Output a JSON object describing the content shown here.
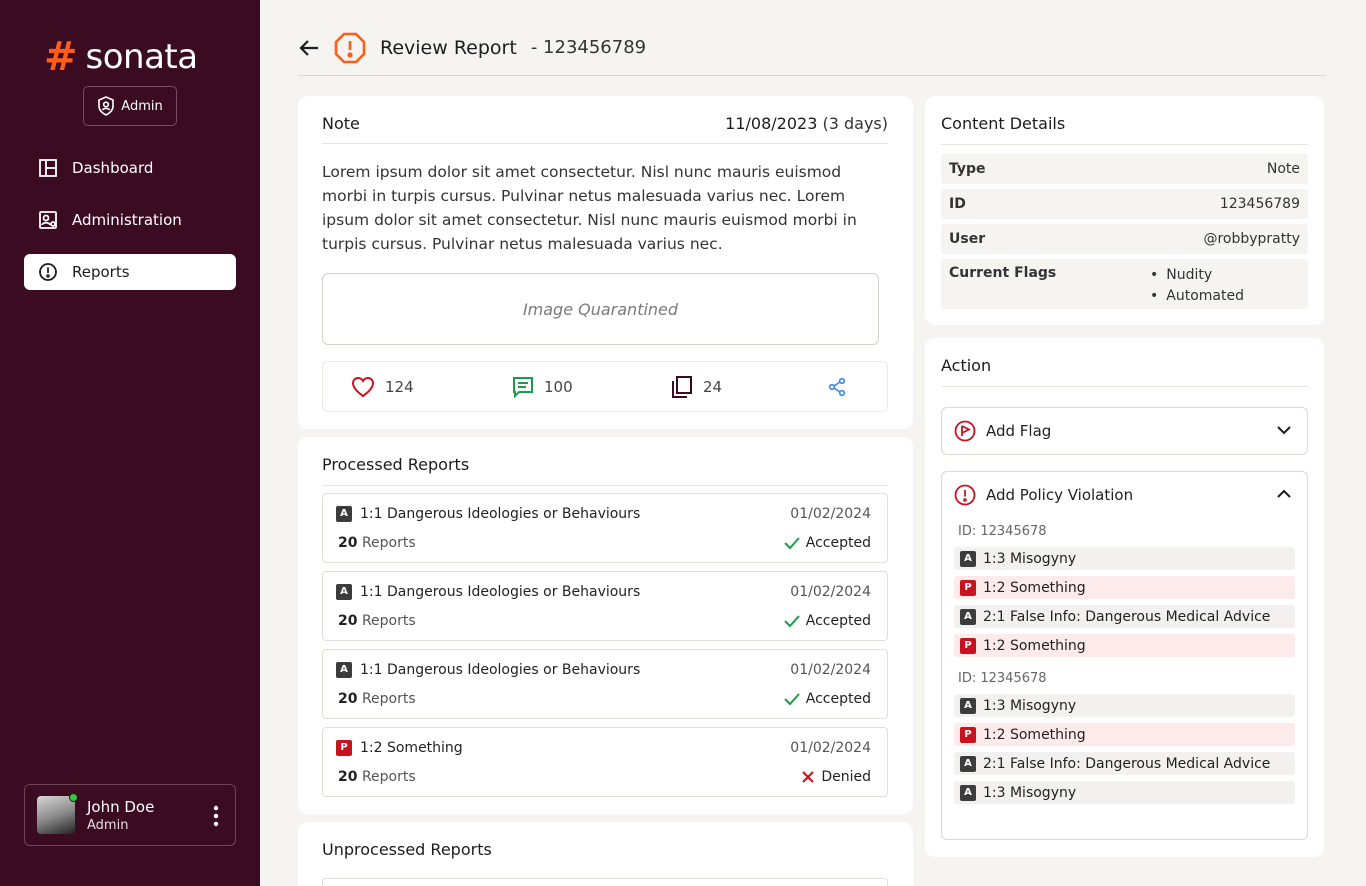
{
  "app": {
    "logo_mark": "#",
    "logo_text": "sonata",
    "role_badge": "Admin",
    "brand_color": "#ff5c1a",
    "sidebar_color": "#3b0b22"
  },
  "nav": [
    {
      "label": "Dashboard",
      "icon": "dashboard-icon"
    },
    {
      "label": "Administration",
      "icon": "administration-icon"
    },
    {
      "label": "Reports",
      "icon": "alert-circle-icon",
      "active": true
    }
  ],
  "user": {
    "name": "John Doe",
    "role": "Admin",
    "status_color": "#2ecc40"
  },
  "header": {
    "title": "Review Report",
    "subtitle": "- 123456789",
    "icon": "warning-octagon-icon"
  },
  "note": {
    "title": "Note",
    "date": "11/08/2023",
    "age": "(3 days)",
    "body": "Lorem ipsum dolor sit amet consectetur. Nisl nunc mauris euismod morbi in turpis cursus. Pulvinar netus malesuada varius nec.  Lorem ipsum dolor sit amet consectetur. Nisl nunc mauris euismod morbi in turpis cursus. Pulvinar netus malesuada varius nec.",
    "image_placeholder": "Image Quarantined",
    "likes": "124",
    "comments": "100",
    "copies": "24"
  },
  "processed": {
    "title": "Processed Reports",
    "reports": [
      {
        "tag": "A",
        "label": "1:1 Dangerous Ideologies or Behaviours",
        "date": "01/02/2024",
        "count": "20",
        "count_label": "Reports",
        "status": "Accepted"
      },
      {
        "tag": "A",
        "label": "1:1 Dangerous Ideologies or Behaviours",
        "date": "01/02/2024",
        "count": "20",
        "count_label": "Reports",
        "status": "Accepted"
      },
      {
        "tag": "A",
        "label": "1:1 Dangerous Ideologies or Behaviours",
        "date": "01/02/2024",
        "count": "20",
        "count_label": "Reports",
        "status": "Accepted"
      },
      {
        "tag": "P",
        "label": "1:2 Something",
        "date": "01/02/2024",
        "count": "20",
        "count_label": "Reports",
        "status": "Denied"
      }
    ]
  },
  "unprocessed": {
    "title": "Unprocessed Reports"
  },
  "details": {
    "title": "Content Details",
    "rows": [
      {
        "key": "Type",
        "value": "Note"
      },
      {
        "key": "ID",
        "value": "123456789"
      },
      {
        "key": "User",
        "value": "@robbypratty"
      }
    ],
    "flags_label": "Current Flags",
    "flags": [
      "Nudity",
      "Automated"
    ]
  },
  "action": {
    "title": "Action",
    "add_flag": "Add Flag",
    "add_policy": "Add Policy Violation",
    "groups": [
      {
        "id": "ID: 12345678",
        "items": [
          {
            "tag": "A",
            "label": "1:3 Misogyny"
          },
          {
            "tag": "P",
            "label": "1:2 Something"
          },
          {
            "tag": "A",
            "label": "2:1 False Info: Dangerous Medical Advice"
          },
          {
            "tag": "P",
            "label": "1:2 Something"
          }
        ]
      },
      {
        "id": "ID: 12345678",
        "items": [
          {
            "tag": "A",
            "label": "1:3 Misogyny"
          },
          {
            "tag": "P",
            "label": "1:2 Something"
          },
          {
            "tag": "A",
            "label": "2:1 False Info: Dangerous Medical Advice"
          },
          {
            "tag": "A",
            "label": "1:3 Misogyny"
          }
        ]
      }
    ]
  }
}
